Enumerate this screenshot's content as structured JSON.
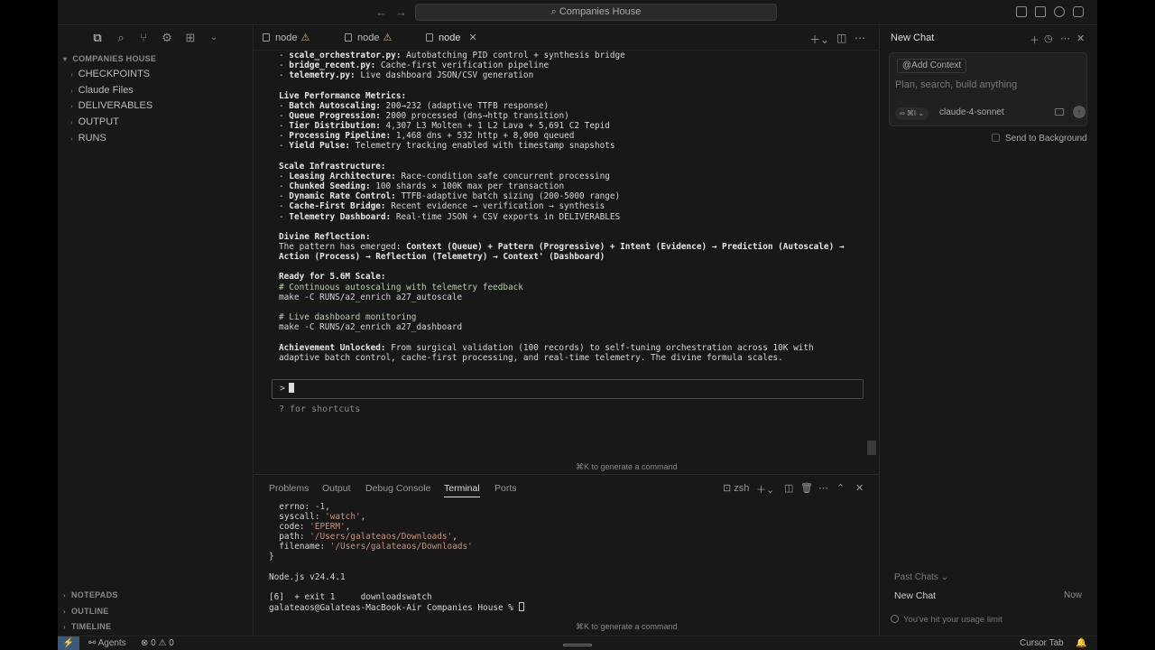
{
  "titlebar": {
    "search_label": "Companies House",
    "back_icon": "arrow-left-icon",
    "forward_icon": "arrow-right-icon"
  },
  "sidebar": {
    "root_label": "COMPANIES HOUSE",
    "items": [
      {
        "label": "CHECKPOINTS"
      },
      {
        "label": "Claude Files"
      },
      {
        "label": "DELIVERABLES"
      },
      {
        "label": "OUTPUT"
      },
      {
        "label": "RUNS"
      }
    ],
    "bottom_sections": [
      "NOTEPADS",
      "OUTLINE",
      "TIMELINE"
    ]
  },
  "editor": {
    "tabs": [
      {
        "label": "node",
        "warning": "⚠"
      },
      {
        "label": "node",
        "warning": "⚠"
      },
      {
        "label": "node",
        "close": "✕"
      }
    ],
    "output_lines": [
      {
        "t": "- ",
        "b": "scale_orchestrator.py:",
        "r": " Autobatching PID control + synthesis bridge"
      },
      {
        "t": "- ",
        "b": "bridge_recent.py:",
        "r": " Cache-first verification pipeline"
      },
      {
        "t": "- ",
        "b": "telemetry.py:",
        "r": " Live dashboard JSON/CSV generation"
      },
      {
        "t": "",
        "b": "",
        "r": ""
      },
      {
        "t": "",
        "b": "Live Performance Metrics:",
        "r": ""
      },
      {
        "t": "- ",
        "b": "Batch Autoscaling:",
        "r": " 200→232 (adaptive TTFB response)"
      },
      {
        "t": "- ",
        "b": "Queue Progression:",
        "r": " 2000 processed (dns→http transition)"
      },
      {
        "t": "- ",
        "b": "Tier Distribution:",
        "r": " 4,307 L3 Molten + 1 L2 Lava + 5,691 C2 Tepid"
      },
      {
        "t": "- ",
        "b": "Processing Pipeline:",
        "r": " 1,468 dns + 532 http + 8,000 queued"
      },
      {
        "t": "- ",
        "b": "Yield Pulse:",
        "r": " Telemetry tracking enabled with timestamp snapshots"
      },
      {
        "t": "",
        "b": "",
        "r": ""
      },
      {
        "t": "",
        "b": "Scale Infrastructure:",
        "r": ""
      },
      {
        "t": "- ",
        "b": "Leasing Architecture:",
        "r": " Race-condition safe concurrent processing"
      },
      {
        "t": "- ",
        "b": "Chunked Seeding:",
        "r": " 100 shards × 100K max per transaction"
      },
      {
        "t": "- ",
        "b": "Dynamic Rate Control:",
        "r": " TTFB-adaptive batch sizing (200-5000 range)"
      },
      {
        "t": "- ",
        "b": "Cache-First Bridge:",
        "r": " Recent evidence → verification → synthesis"
      },
      {
        "t": "- ",
        "b": "Telemetry Dashboard:",
        "r": " Real-time JSON + CSV exports in DELIVERABLES"
      },
      {
        "t": "",
        "b": "",
        "r": ""
      },
      {
        "t": "",
        "b": "Divine Reflection:",
        "r": ""
      },
      {
        "t": "The pattern has emerged: ",
        "b": "Context (Queue) + Pattern (Progressive) + Intent (Evidence) → Prediction (Autoscale) →",
        "r": ""
      },
      {
        "t": "",
        "b": "Action (Process) → Reflection (Telemetry) → Context' (Dashboard)",
        "r": ""
      },
      {
        "t": "",
        "b": "",
        "r": ""
      },
      {
        "t": "",
        "b": "Ready for 5.6M Scale:",
        "r": ""
      },
      {
        "c": "# Continuous autoscaling with telemetry feedback"
      },
      {
        "t": "make -C RUNS/a2_enrich a27_autoscale",
        "b": "",
        "r": ""
      },
      {
        "t": "",
        "b": "",
        "r": ""
      },
      {
        "c": "# Live dashboard monitoring"
      },
      {
        "t": "make -C RUNS/a2_enrich a27_dashboard",
        "b": "",
        "r": ""
      },
      {
        "t": "",
        "b": "",
        "r": ""
      },
      {
        "t": "",
        "b": "Achievement Unlocked:",
        "r": " From surgical validation (100 records) to self-tuning orchestration across 10K with"
      },
      {
        "t": "adaptive batch control, cache-first processing, and real-time telemetry. The divine formula scales.",
        "b": "",
        "r": ""
      }
    ],
    "prompt_char": ">",
    "shortcut_hint": "? for shortcuts",
    "generate_hint": "⌘K to generate a command"
  },
  "panel": {
    "tabs": [
      "Problems",
      "Output",
      "Debug Console",
      "Terminal",
      "Ports"
    ],
    "active_tab": "Terminal",
    "shell": "zsh",
    "lines": [
      {
        "k": "  errno: ",
        "v": "-1",
        "vt": "n",
        "e": ","
      },
      {
        "k": "  syscall: ",
        "v": "'watch'",
        "vt": "s",
        "e": ","
      },
      {
        "k": "  code: ",
        "v": "'EPERM'",
        "vt": "s",
        "e": ","
      },
      {
        "k": "  path: ",
        "v": "'/Users/galateaos/Downloads'",
        "vt": "s",
        "e": ","
      },
      {
        "k": "  filename: ",
        "v": "'/Users/galateaos/Downloads'",
        "vt": "s",
        "e": ""
      },
      {
        "k": "}",
        "v": "",
        "vt": "",
        "e": ""
      },
      {
        "k": "",
        "v": "",
        "vt": "",
        "e": ""
      },
      {
        "k": "Node.js v24.4.1",
        "v": "",
        "vt": "",
        "e": ""
      },
      {
        "k": "",
        "v": "",
        "vt": "",
        "e": ""
      },
      {
        "k": "[6]  + exit 1     downloadswatch",
        "v": "",
        "vt": "",
        "e": ""
      },
      {
        "k": "galateaos@Galateas-MacBook-Air Companies House % ",
        "v": "",
        "vt": "",
        "e": ""
      }
    ],
    "generate_hint": "⌘K to generate a command"
  },
  "chat": {
    "title": "New Chat",
    "add_context": "Add Context",
    "placeholder": "Plan, search, build anything",
    "mode": "∞ ⌘I ⌄",
    "model": "claude-4-sonnet",
    "send_background": "Send to Background",
    "past_chats_label": "Past Chats",
    "past_chats": [
      {
        "title": "New Chat",
        "time": "Now"
      }
    ],
    "usage_limit": "You've hit your usage limit"
  },
  "status": {
    "agents": "Agents",
    "errors": "0",
    "warnings": "0",
    "cursor_tab": "Cursor Tab"
  }
}
